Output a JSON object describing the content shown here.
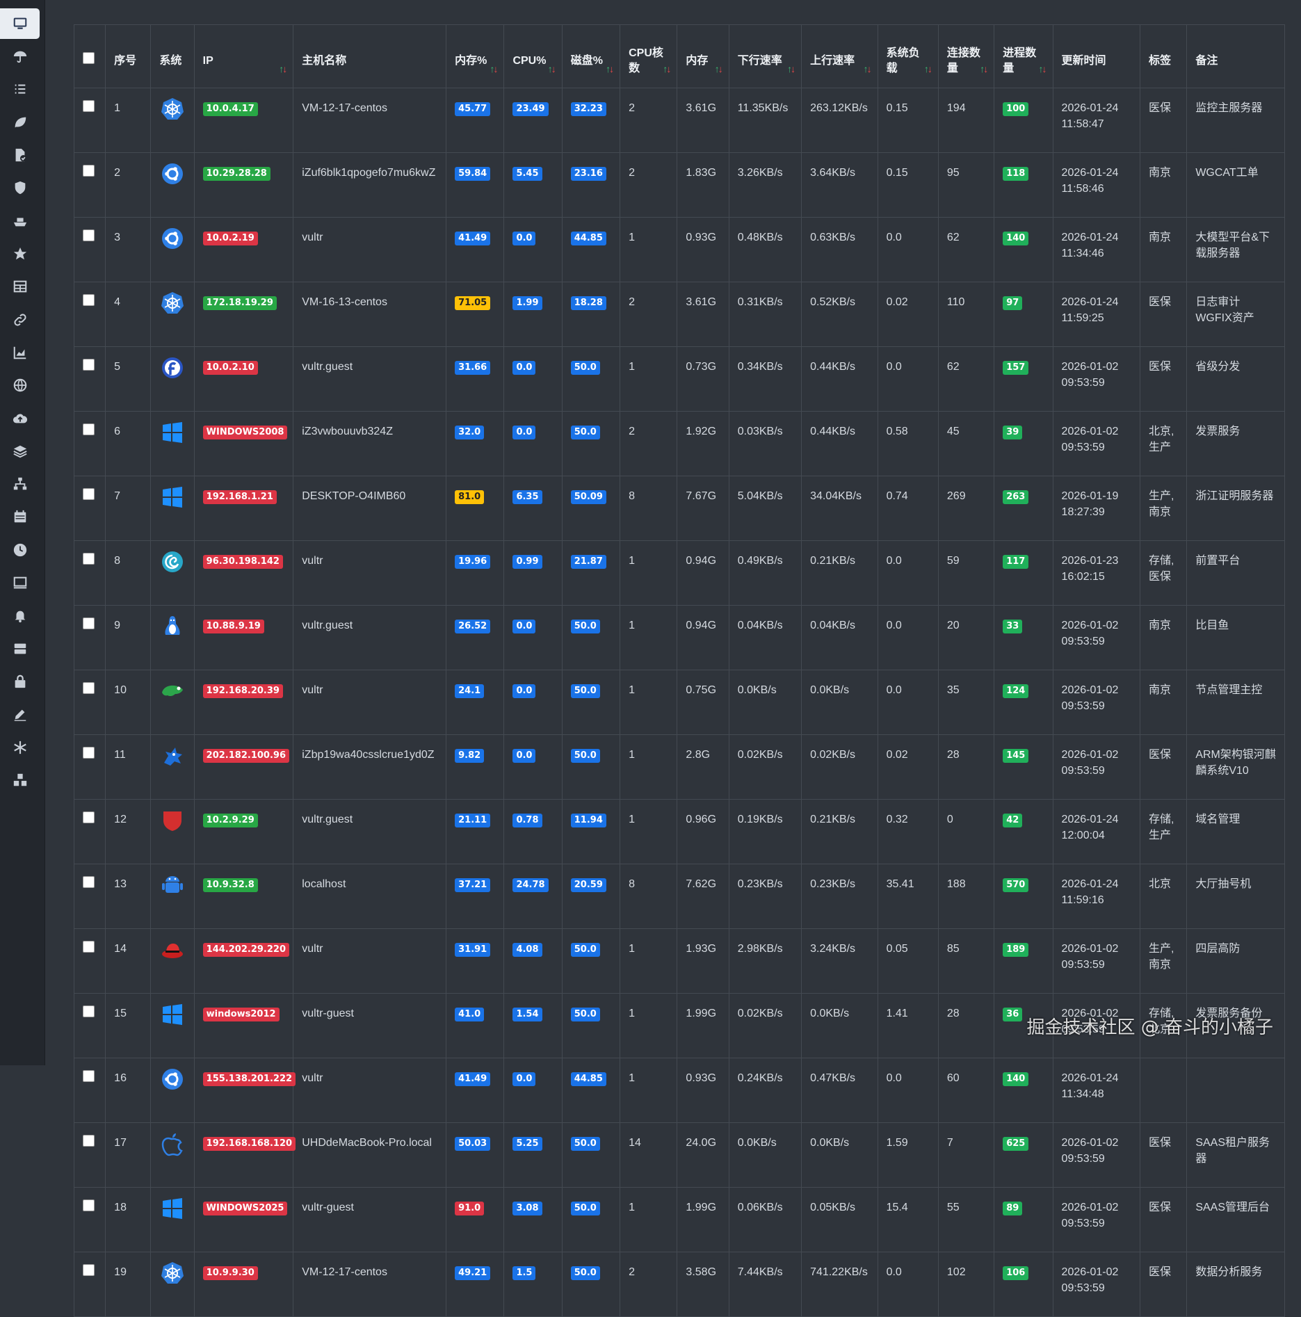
{
  "sidebar_icons": [
    "monitor-icon",
    "umbrella-icon",
    "list-icon",
    "leaf-icon",
    "file-check-icon",
    "shield-icon",
    "ship-icon",
    "star-icon",
    "table-icon",
    "link-icon",
    "chart-icon",
    "globe-icon",
    "cloud-upload-icon",
    "layers-icon",
    "network-icon",
    "calendar-icon",
    "clock-icon",
    "screen-icon",
    "bell-icon",
    "server-icon",
    "lock-icon",
    "edit-icon",
    "snowflake-icon",
    "cubes-icon"
  ],
  "headers": {
    "seq": "序号",
    "os": "系统",
    "ip": "IP",
    "host": "主机名称",
    "mem_pct": "内存%",
    "cpu_pct": "CPU%",
    "disk_pct": "磁盘%",
    "cores": "CPU核数",
    "mem": "内存",
    "down": "下行速率",
    "up": "上行速率",
    "load": "系统负载",
    "conn": "连接数量",
    "proc": "进程数量",
    "updated": "更新时间",
    "tag": "标签",
    "note": "备注"
  },
  "sort_glyph": "↑↓",
  "rows": [
    {
      "seq": "1",
      "os": "kubernetes",
      "ip": "10.0.4.17",
      "ip_color": "green",
      "host": "VM-12-17-centos",
      "mem": "45.77",
      "mem_c": "blue",
      "cpu": "23.49",
      "cpu_c": "blue",
      "disk": "32.23",
      "disk_c": "blue",
      "cores": "2",
      "memsz": "3.61G",
      "down": "11.35KB/s",
      "up": "263.12KB/s",
      "load": "0.15",
      "conn": "194",
      "proc": "100",
      "date": "2026-01-24",
      "time": "11:58:47",
      "tag": "医保",
      "note": "监控主服务器"
    },
    {
      "seq": "2",
      "os": "ubuntu",
      "ip": "10.29.28.28",
      "ip_color": "green",
      "host": "iZuf6blk1qpogefo7mu6kwZ",
      "mem": "59.84",
      "mem_c": "blue",
      "cpu": "5.45",
      "cpu_c": "blue",
      "disk": "23.16",
      "disk_c": "blue",
      "cores": "2",
      "memsz": "1.83G",
      "down": "3.26KB/s",
      "up": "3.64KB/s",
      "load": "0.15",
      "conn": "95",
      "proc": "118",
      "date": "2026-01-24",
      "time": "11:58:46",
      "tag": "南京",
      "note": "WGCAT工单"
    },
    {
      "seq": "3",
      "os": "ubuntu",
      "ip": "10.0.2.19",
      "ip_color": "red",
      "host": "vultr",
      "mem": "41.49",
      "mem_c": "blue",
      "cpu": "0.0",
      "cpu_c": "blue",
      "disk": "44.85",
      "disk_c": "blue",
      "cores": "1",
      "memsz": "0.93G",
      "down": "0.48KB/s",
      "up": "0.63KB/s",
      "load": "0.0",
      "conn": "62",
      "proc": "140",
      "date": "2026-01-24",
      "time": "11:34:46",
      "tag": "南京",
      "note": "大模型平台&下载服务器"
    },
    {
      "seq": "4",
      "os": "kubernetes",
      "ip": "172.18.19.29",
      "ip_color": "green",
      "host": "VM-16-13-centos",
      "mem": "71.05",
      "mem_c": "yellow",
      "cpu": "1.99",
      "cpu_c": "blue",
      "disk": "18.28",
      "disk_c": "blue",
      "cores": "2",
      "memsz": "3.61G",
      "down": "0.31KB/s",
      "up": "0.52KB/s",
      "load": "0.02",
      "conn": "110",
      "proc": "97",
      "date": "2026-01-24",
      "time": "11:59:25",
      "tag": "医保",
      "note": "日志审计WGFIX资产"
    },
    {
      "seq": "5",
      "os": "fedora",
      "ip": "10.0.2.10",
      "ip_color": "red",
      "host": "vultr.guest",
      "mem": "31.66",
      "mem_c": "blue",
      "cpu": "0.0",
      "cpu_c": "blue",
      "disk": "50.0",
      "disk_c": "blue",
      "cores": "1",
      "memsz": "0.73G",
      "down": "0.34KB/s",
      "up": "0.44KB/s",
      "load": "0.0",
      "conn": "62",
      "proc": "157",
      "date": "2026-01-02",
      "time": "09:53:59",
      "tag": "医保",
      "note": "省级分发"
    },
    {
      "seq": "6",
      "os": "windows",
      "ip": "WINDOWS2008",
      "ip_color": "red",
      "host": "iZ3vwbouuvb324Z",
      "mem": "32.0",
      "mem_c": "blue",
      "cpu": "0.0",
      "cpu_c": "blue",
      "disk": "50.0",
      "disk_c": "blue",
      "cores": "2",
      "memsz": "1.92G",
      "down": "0.03KB/s",
      "up": "0.44KB/s",
      "load": "0.58",
      "conn": "45",
      "proc": "39",
      "date": "2026-01-02",
      "time": "09:53:59",
      "tag": "北京,生产",
      "note": "发票服务"
    },
    {
      "seq": "7",
      "os": "windows",
      "ip": "192.168.1.21",
      "ip_color": "red",
      "host": "DESKTOP-O4IMB60",
      "mem": "81.0",
      "mem_c": "yellow",
      "cpu": "6.35",
      "cpu_c": "blue",
      "disk": "50.09",
      "disk_c": "blue",
      "cores": "8",
      "memsz": "7.67G",
      "down": "5.04KB/s",
      "up": "34.04KB/s",
      "load": "0.74",
      "conn": "269",
      "proc": "263",
      "date": "2026-01-19",
      "time": "18:27:39",
      "tag": "生产,南京",
      "note": "浙江证明服务器"
    },
    {
      "seq": "8",
      "os": "debian",
      "ip": "96.30.198.142",
      "ip_color": "red",
      "host": "vultr",
      "mem": "19.96",
      "mem_c": "blue",
      "cpu": "0.99",
      "cpu_c": "blue",
      "disk": "21.87",
      "disk_c": "blue",
      "cores": "1",
      "memsz": "0.94G",
      "down": "0.49KB/s",
      "up": "0.21KB/s",
      "load": "0.0",
      "conn": "59",
      "proc": "117",
      "date": "2026-01-23",
      "time": "16:02:15",
      "tag": "存储,医保",
      "note": "前置平台"
    },
    {
      "seq": "9",
      "os": "linux",
      "ip": "10.88.9.19",
      "ip_color": "red",
      "host": "vultr.guest",
      "mem": "26.52",
      "mem_c": "blue",
      "cpu": "0.0",
      "cpu_c": "blue",
      "disk": "50.0",
      "disk_c": "blue",
      "cores": "1",
      "memsz": "0.94G",
      "down": "0.04KB/s",
      "up": "0.04KB/s",
      "load": "0.0",
      "conn": "20",
      "proc": "33",
      "date": "2026-01-02",
      "time": "09:53:59",
      "tag": "南京",
      "note": "比目鱼"
    },
    {
      "seq": "10",
      "os": "opensuse",
      "ip": "192.168.20.39",
      "ip_color": "red",
      "host": "vultr",
      "mem": "24.1",
      "mem_c": "blue",
      "cpu": "0.0",
      "cpu_c": "blue",
      "disk": "50.0",
      "disk_c": "blue",
      "cores": "1",
      "memsz": "0.75G",
      "down": "0.0KB/s",
      "up": "0.0KB/s",
      "load": "0.0",
      "conn": "35",
      "proc": "124",
      "date": "2026-01-02",
      "time": "09:53:59",
      "tag": "南京",
      "note": "节点管理主控"
    },
    {
      "seq": "11",
      "os": "kylin",
      "ip": "202.182.100.96",
      "ip_color": "red",
      "host": "iZbp19wa40csslcrue1yd0Z",
      "mem": "9.82",
      "mem_c": "blue",
      "cpu": "0.0",
      "cpu_c": "blue",
      "disk": "50.0",
      "disk_c": "blue",
      "cores": "1",
      "memsz": "2.8G",
      "down": "0.02KB/s",
      "up": "0.02KB/s",
      "load": "0.02",
      "conn": "28",
      "proc": "145",
      "date": "2026-01-02",
      "time": "09:53:59",
      "tag": "医保",
      "note": "ARM架构银河麒麟系统V10"
    },
    {
      "seq": "12",
      "os": "redhat-shield",
      "ip": "10.2.9.29",
      "ip_color": "green",
      "host": "vultr.guest",
      "mem": "21.11",
      "mem_c": "blue",
      "cpu": "0.78",
      "cpu_c": "blue",
      "disk": "11.94",
      "disk_c": "blue",
      "cores": "1",
      "memsz": "0.96G",
      "down": "0.19KB/s",
      "up": "0.21KB/s",
      "load": "0.32",
      "conn": "0",
      "proc": "42",
      "date": "2026-01-24",
      "time": "12:00:04",
      "tag": "存储,生产",
      "note": "域名管理"
    },
    {
      "seq": "13",
      "os": "android",
      "ip": "10.9.32.8",
      "ip_color": "green",
      "host": "localhost",
      "mem": "37.21",
      "mem_c": "blue",
      "cpu": "24.78",
      "cpu_c": "blue",
      "disk": "20.59",
      "disk_c": "blue",
      "cores": "8",
      "memsz": "7.62G",
      "down": "0.23KB/s",
      "up": "0.23KB/s",
      "load": "35.41",
      "conn": "188",
      "proc": "570",
      "date": "2026-01-24",
      "time": "11:59:16",
      "tag": "北京",
      "note": "大厅抽号机"
    },
    {
      "seq": "14",
      "os": "redhat",
      "ip": "144.202.29.220",
      "ip_color": "red",
      "host": "vultr",
      "mem": "31.91",
      "mem_c": "blue",
      "cpu": "4.08",
      "cpu_c": "blue",
      "disk": "50.0",
      "disk_c": "blue",
      "cores": "1",
      "memsz": "1.93G",
      "down": "2.98KB/s",
      "up": "3.24KB/s",
      "load": "0.05",
      "conn": "85",
      "proc": "189",
      "date": "2026-01-02",
      "time": "09:53:59",
      "tag": "生产,南京",
      "note": "四层高防"
    },
    {
      "seq": "15",
      "os": "windows",
      "ip": "windows2012",
      "ip_color": "red",
      "host": "vultr-guest",
      "mem": "41.0",
      "mem_c": "blue",
      "cpu": "1.54",
      "cpu_c": "blue",
      "disk": "50.0",
      "disk_c": "blue",
      "cores": "1",
      "memsz": "1.99G",
      "down": "0.02KB/s",
      "up": "0.0KB/s",
      "load": "1.41",
      "conn": "28",
      "proc": "36",
      "date": "2026-01-02",
      "time": "09:53:59",
      "tag": "存储,北京",
      "note": "发票服务备份"
    },
    {
      "seq": "16",
      "os": "ubuntu",
      "ip": "155.138.201.222",
      "ip_color": "red",
      "host": "vultr",
      "mem": "41.49",
      "mem_c": "blue",
      "cpu": "0.0",
      "cpu_c": "blue",
      "disk": "44.85",
      "disk_c": "blue",
      "cores": "1",
      "memsz": "0.93G",
      "down": "0.24KB/s",
      "up": "0.47KB/s",
      "load": "0.0",
      "conn": "60",
      "proc": "140",
      "date": "2026-01-24",
      "time": "11:34:48",
      "tag": "",
      "note": ""
    },
    {
      "seq": "17",
      "os": "apple",
      "ip": "192.168.168.120",
      "ip_color": "red",
      "host": "UHDdeMacBook-Pro.local",
      "mem": "50.03",
      "mem_c": "blue",
      "cpu": "5.25",
      "cpu_c": "blue",
      "disk": "50.0",
      "disk_c": "blue",
      "cores": "14",
      "memsz": "24.0G",
      "down": "0.0KB/s",
      "up": "0.0KB/s",
      "load": "1.59",
      "conn": "7",
      "proc": "625",
      "date": "2026-01-02",
      "time": "09:53:59",
      "tag": "医保",
      "note": "SAAS租户服务器"
    },
    {
      "seq": "18",
      "os": "windows",
      "ip": "WINDOWS2025",
      "ip_color": "red",
      "host": "vultr-guest",
      "mem": "91.0",
      "mem_c": "red",
      "cpu": "3.08",
      "cpu_c": "blue",
      "disk": "50.0",
      "disk_c": "blue",
      "cores": "1",
      "memsz": "1.99G",
      "down": "0.06KB/s",
      "up": "0.05KB/s",
      "load": "15.4",
      "conn": "55",
      "proc": "89",
      "date": "2026-01-02",
      "time": "09:53:59",
      "tag": "医保",
      "note": "SAAS管理后台"
    },
    {
      "seq": "19",
      "os": "kubernetes",
      "ip": "10.9.9.30",
      "ip_color": "red",
      "host": "VM-12-17-centos",
      "mem": "49.21",
      "mem_c": "blue",
      "cpu": "1.5",
      "cpu_c": "blue",
      "disk": "50.0",
      "disk_c": "blue",
      "cores": "2",
      "memsz": "3.58G",
      "down": "7.44KB/s",
      "up": "741.22KB/s",
      "load": "0.0",
      "conn": "102",
      "proc": "106",
      "date": "2026-01-02",
      "time": "09:53:59",
      "tag": "医保",
      "note": "数据分析服务"
    }
  ],
  "watermark": "掘金技术社区 @ 奋斗的小橘子"
}
